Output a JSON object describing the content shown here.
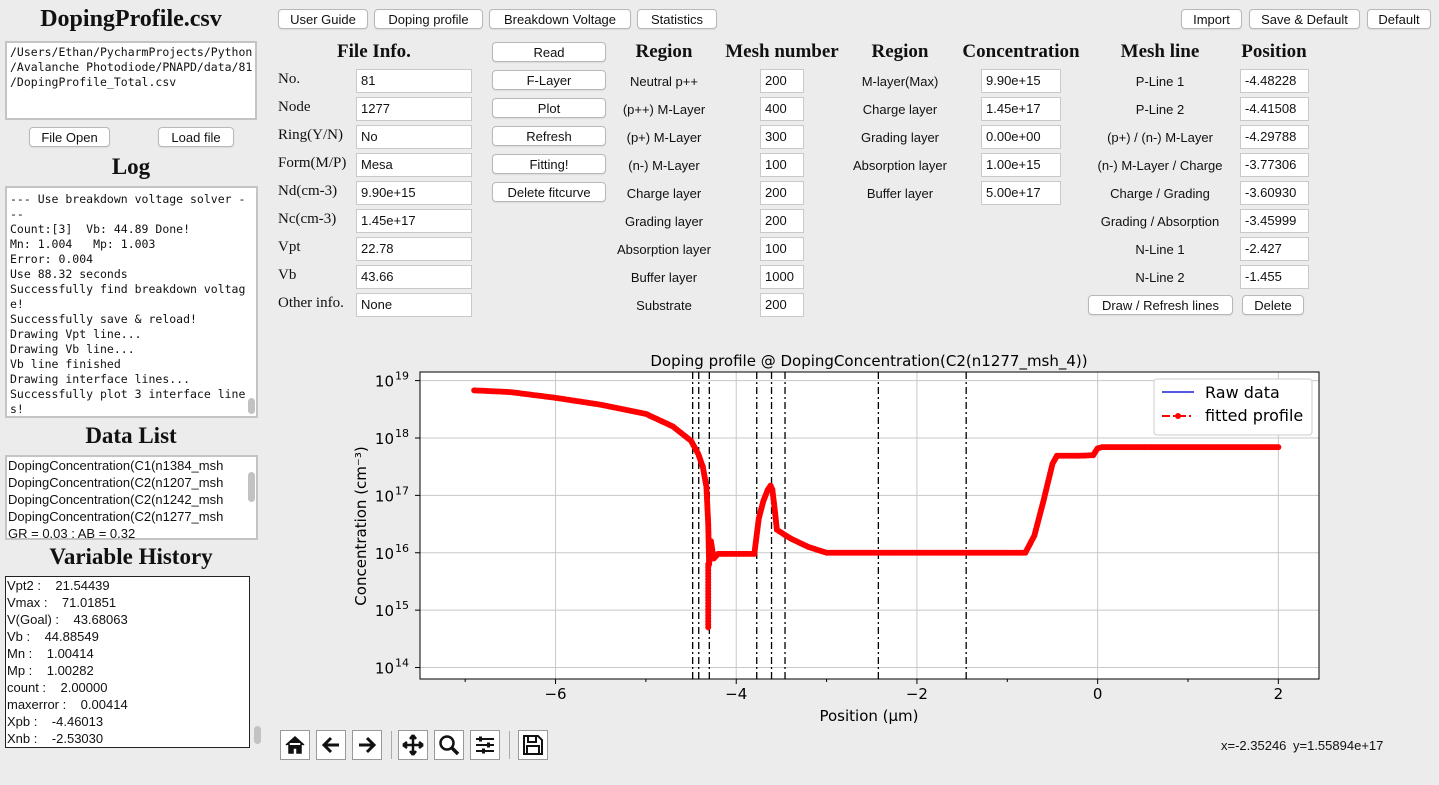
{
  "left": {
    "filename": "DopingProfile.csv",
    "path_lines": [
      "/Users/Ethan/PycharmProjects/Python",
      "/Avalanche Photodiode/PNAPD/data/81",
      "/DopingProfile_Total.csv"
    ],
    "file_open": "File Open",
    "load_file": "Load file",
    "log_title": "Log",
    "log_lines": [
      "--- Use breakdown voltage solver -",
      "--",
      "Count:[3]  Vb: 44.89 Done!",
      "Mn: 1.004   Mp: 1.003",
      "Error: 0.004",
      "Use 88.32 seconds",
      "Successfully find breakdown voltag",
      "e!",
      "Successfully save & reload!",
      "Drawing Vpt line...",
      "Drawing Vb line...",
      "Vb line finished",
      "Drawing interface lines...",
      "Successfully plot 3 interface line",
      "s!"
    ],
    "data_list_title": "Data List",
    "data_list": [
      "DopingConcentration(C1(n1384_msh",
      "DopingConcentration(C2(n1207_msh",
      "DopingConcentration(C2(n1242_msh",
      "DopingConcentration(C2(n1277_msh"
    ],
    "data_list_footer": "GR = 0.03 ; AB = 0.32",
    "var_title": "Variable History",
    "var_lines": [
      "Vpt2 :    21.54439",
      "Vmax :    71.01851",
      "V(Goal) :    43.68063",
      "Vb :    44.88549",
      "Mn :    1.00414",
      "Mp :    1.00282",
      "count :    2.00000",
      "maxerror :    0.00414",
      "Xpb :    -4.46013",
      "Xnb :    -2.53030"
    ]
  },
  "topbar": {
    "tabs": [
      "User Guide",
      "Doping profile",
      "Breakdown Voltage",
      "Statistics"
    ],
    "right": [
      "Import",
      "Save & Default",
      "Default"
    ]
  },
  "fileinfo": {
    "title": "File Info.",
    "rows": [
      {
        "label": "No.",
        "value": "81"
      },
      {
        "label": "Node",
        "value": "1277"
      },
      {
        "label": "Ring(Y/N)",
        "value": "No"
      },
      {
        "label": "Form(M/P)",
        "value": "Mesa"
      },
      {
        "label": "Nd(cm-3)",
        "value": "9.90e+15"
      },
      {
        "label": "Nc(cm-3)",
        "value": "1.45e+17"
      },
      {
        "label": "Vpt",
        "value": "22.78"
      },
      {
        "label": "Vb",
        "value": "43.66"
      },
      {
        "label": "Other info.",
        "value": "None"
      }
    ]
  },
  "actions": [
    "Read",
    "F-Layer",
    "Plot",
    "Refresh",
    "Fitting!",
    "Delete fitcurve"
  ],
  "mesh": {
    "region_title": "Region",
    "mesh_title": "Mesh number",
    "rows": [
      {
        "region": "Neutral p++",
        "value": "200"
      },
      {
        "region": "(p++) M-Layer",
        "value": "400"
      },
      {
        "region": "(p+) M-Layer",
        "value": "300"
      },
      {
        "region": "(n-) M-Layer",
        "value": "100"
      },
      {
        "region": "Charge layer",
        "value": "200"
      },
      {
        "region": "Grading layer",
        "value": "200"
      },
      {
        "region": "Absorption layer",
        "value": "100"
      },
      {
        "region": "Buffer layer",
        "value": "1000"
      },
      {
        "region": "Substrate",
        "value": "200"
      }
    ]
  },
  "conc": {
    "region_title": "Region",
    "conc_title": "Concentration",
    "rows": [
      {
        "region": "M-layer(Max)",
        "value": "9.90e+15"
      },
      {
        "region": "Charge layer",
        "value": "1.45e+17"
      },
      {
        "region": "Grading layer",
        "value": "0.00e+00"
      },
      {
        "region": "Absorption layer",
        "value": "1.00e+15"
      },
      {
        "region": "Buffer layer",
        "value": "5.00e+17"
      }
    ]
  },
  "meshline": {
    "line_title": "Mesh line",
    "pos_title": "Position",
    "rows": [
      {
        "label": "P-Line 1",
        "value": "-4.48228"
      },
      {
        "label": "P-Line 2",
        "value": "-4.41508"
      },
      {
        "label": "(p+) / (n-) M-Layer",
        "value": "-4.29788"
      },
      {
        "label": "(n-) M-Layer / Charge",
        "value": "-3.77306"
      },
      {
        "label": "Charge / Grading",
        "value": "-3.60930"
      },
      {
        "label": "Grading / Absorption",
        "value": "-3.45999"
      },
      {
        "label": "N-Line 1",
        "value": "-2.427"
      },
      {
        "label": "N-Line 2",
        "value": "-1.455"
      }
    ],
    "draw": "Draw / Refresh lines",
    "delete": "Delete"
  },
  "chart_data": {
    "type": "line",
    "title": "Doping profile @ DopingConcentration(C2(n1277_msh_4))",
    "xlabel": "Position (μm)",
    "ylabel": "Concentration (cm⁻³)",
    "xlim": [
      -7.5,
      2.45
    ],
    "ylim_log10": [
      13.8,
      19.15
    ],
    "yscale": "log",
    "xticks": [
      -6,
      -4,
      -2,
      0,
      2
    ],
    "xtick_labels": [
      "−6",
      "−4",
      "−2",
      "0",
      "2"
    ],
    "yticks_exp": [
      14,
      15,
      16,
      17,
      18,
      19
    ],
    "ytick_base": "10",
    "grid": true,
    "legend_position": "upper right",
    "legend": [
      {
        "name": "Raw data",
        "color": "#1f1fd6",
        "style": "solid"
      },
      {
        "name": "fitted profile",
        "color": "#ff0000",
        "style": "dash-dot with markers"
      }
    ],
    "vertical_lines_x": [
      -4.48228,
      -4.41508,
      -4.29788,
      -3.77306,
      -3.6093,
      -3.45999,
      -2.427,
      -1.455
    ],
    "series": [
      {
        "name": "fitted profile",
        "color": "#ff0000",
        "x": [
          -6.9,
          -6.5,
          -6.0,
          -5.5,
          -5.0,
          -4.7,
          -4.5,
          -4.42,
          -4.37,
          -4.33,
          -4.31,
          -4.3,
          -4.28,
          -4.25,
          -4.2,
          -4.0,
          -3.8,
          -3.75,
          -3.7,
          -3.65,
          -3.62,
          -3.6,
          -3.57,
          -3.55,
          -3.5,
          -3.4,
          -3.2,
          -3.0,
          -2.5,
          -2.0,
          -1.5,
          -1.0,
          -0.8,
          -0.7,
          -0.6,
          -0.5,
          -0.45,
          -0.2,
          -0.05,
          0.0,
          0.05,
          0.5,
          1.0,
          2.0
        ],
        "log10_y": [
          18.83,
          18.8,
          18.7,
          18.58,
          18.42,
          18.2,
          17.95,
          17.72,
          17.5,
          17.15,
          16.5,
          15.8,
          16.2,
          15.9,
          15.98,
          15.98,
          15.98,
          16.6,
          16.9,
          17.1,
          17.17,
          17.1,
          16.7,
          16.4,
          16.35,
          16.25,
          16.1,
          16.0,
          16.0,
          16.0,
          16.0,
          16.0,
          16.0,
          16.3,
          16.9,
          17.55,
          17.69,
          17.69,
          17.7,
          17.82,
          17.84,
          17.84,
          17.84,
          17.84
        ]
      }
    ],
    "dip": {
      "x": -4.31,
      "log10_y_min": 14.65
    },
    "coord_readout": {
      "x": "x=-2.35246",
      "y": "y=1.55894e+17"
    }
  },
  "toolbar": [
    "home-icon",
    "back-icon",
    "forward-icon",
    "pan-icon",
    "zoom-icon",
    "configure-icon",
    "save-icon"
  ]
}
